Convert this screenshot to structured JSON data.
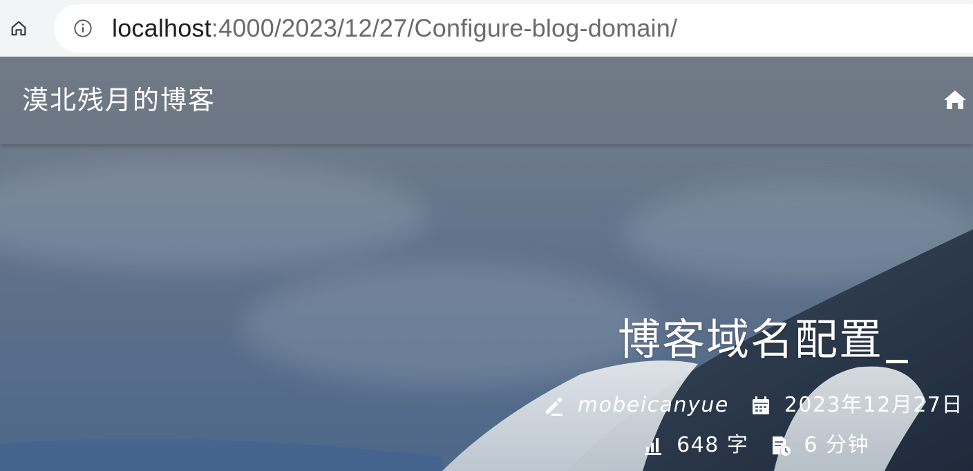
{
  "browser": {
    "url_host": "localhost",
    "url_rest": ":4000/2023/12/27/Configure-blog-domain/",
    "home_icon": "home-icon",
    "info_icon": "info-icon"
  },
  "navbar": {
    "site_title": "漠北残月的博客",
    "home_icon": "home-icon"
  },
  "post": {
    "title": "博客域名配置",
    "author": "mobeicanyue",
    "date": "2023年12月27日",
    "word_count": "648 字",
    "read_time": "6 分钟"
  },
  "colors": {
    "hero_top": "#7a8290",
    "hero_bottom": "#4d6789",
    "text": "#ffffff",
    "browser_bar": "#f2f4f6"
  }
}
